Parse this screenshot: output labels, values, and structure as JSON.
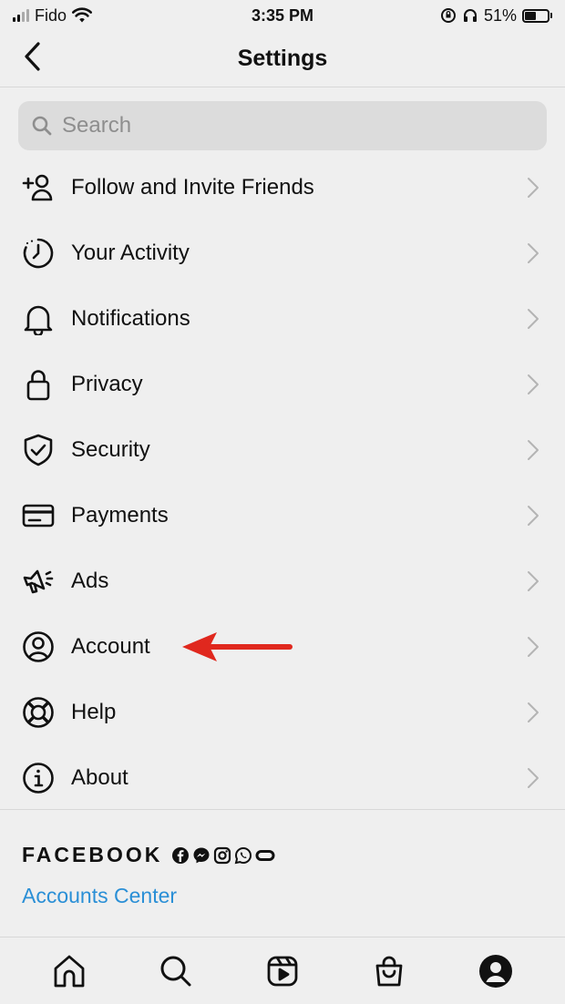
{
  "status_bar": {
    "carrier": "Fido",
    "time": "3:35 PM",
    "battery_pct": "51%",
    "battery_level": 0.51
  },
  "header": {
    "title": "Settings"
  },
  "search": {
    "placeholder": "Search"
  },
  "menu": {
    "items": [
      {
        "label": "Follow and Invite Friends",
        "icon": "add-person-icon"
      },
      {
        "label": "Your Activity",
        "icon": "activity-clock-icon"
      },
      {
        "label": "Notifications",
        "icon": "bell-icon"
      },
      {
        "label": "Privacy",
        "icon": "lock-icon"
      },
      {
        "label": "Security",
        "icon": "shield-check-icon"
      },
      {
        "label": "Payments",
        "icon": "card-icon"
      },
      {
        "label": "Ads",
        "icon": "megaphone-icon"
      },
      {
        "label": "Account",
        "icon": "user-circle-icon"
      },
      {
        "label": "Help",
        "icon": "lifebuoy-icon"
      },
      {
        "label": "About",
        "icon": "info-icon"
      }
    ]
  },
  "facebook": {
    "wordmark": "FACEBOOK",
    "link": "Accounts Center"
  },
  "tabbar": {
    "tabs": [
      "home-icon",
      "search-icon",
      "reels-icon",
      "shop-icon",
      "profile-icon"
    ]
  },
  "colors": {
    "background": "#efefef",
    "link": "#2a8fd6",
    "annotation": "#e0281e"
  }
}
